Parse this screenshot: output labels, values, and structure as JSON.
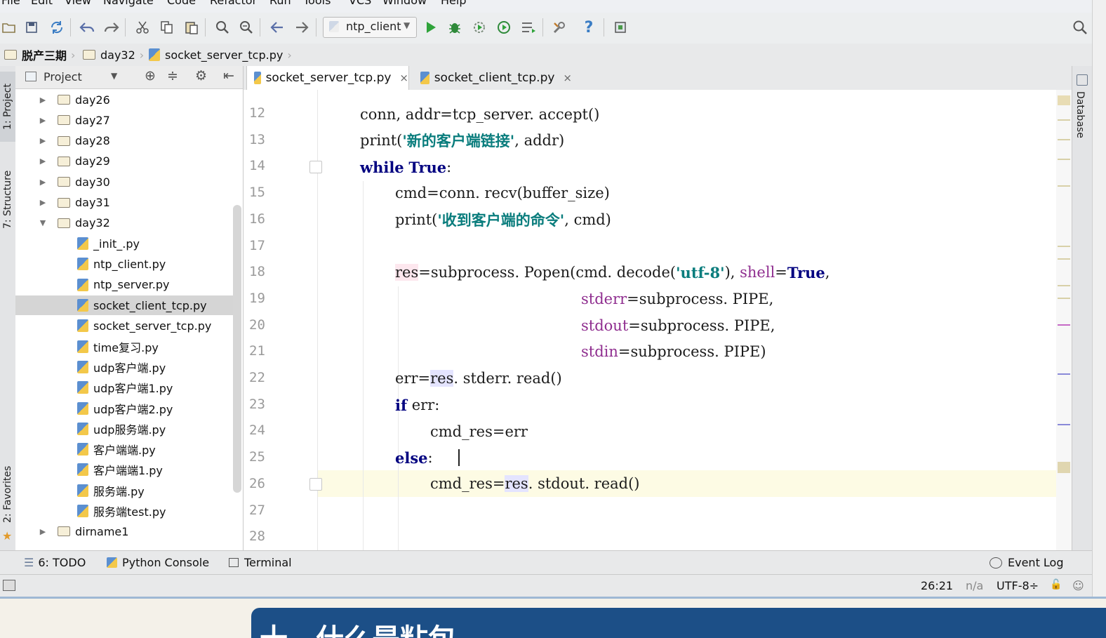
{
  "menu": [
    "File",
    "Edit",
    "View",
    "Navigate",
    "Code",
    "Refactor",
    "Run",
    "Tools",
    "VCS",
    "Window",
    "Help"
  ],
  "toolbar": {
    "run_config": "ntp_client"
  },
  "breadcrumb": [
    "脱产三期",
    "day32",
    "socket_server_tcp.py"
  ],
  "left_tabs": [
    "1: Project",
    "7: Structure",
    "2: Favorites"
  ],
  "right_tabs": [
    "Database"
  ],
  "project": {
    "header": "Project",
    "tree": [
      {
        "label": "day26",
        "type": "folder",
        "arrow": "▶",
        "level": 0
      },
      {
        "label": "day27",
        "type": "folder",
        "arrow": "▶",
        "level": 0
      },
      {
        "label": "day28",
        "type": "folder",
        "arrow": "▶",
        "level": 0
      },
      {
        "label": "day29",
        "type": "folder",
        "arrow": "▶",
        "level": 0
      },
      {
        "label": "day30",
        "type": "folder",
        "arrow": "▶",
        "level": 0
      },
      {
        "label": "day31",
        "type": "folder",
        "arrow": "▶",
        "level": 0
      },
      {
        "label": "day32",
        "type": "folder",
        "arrow": "▼",
        "level": 0
      },
      {
        "label": "_init_.py",
        "type": "file",
        "level": 1
      },
      {
        "label": "ntp_client.py",
        "type": "file",
        "level": 1
      },
      {
        "label": "ntp_server.py",
        "type": "file",
        "level": 1
      },
      {
        "label": "socket_client_tcp.py",
        "type": "file",
        "level": 1,
        "selected": true
      },
      {
        "label": "socket_server_tcp.py",
        "type": "file",
        "level": 1
      },
      {
        "label": "time复习.py",
        "type": "file",
        "level": 1
      },
      {
        "label": "udp客户端.py",
        "type": "file",
        "level": 1
      },
      {
        "label": "udp客户端1.py",
        "type": "file",
        "level": 1
      },
      {
        "label": "udp客户端2.py",
        "type": "file",
        "level": 1
      },
      {
        "label": "udp服务端.py",
        "type": "file",
        "level": 1
      },
      {
        "label": "客户端端.py",
        "type": "file",
        "level": 1
      },
      {
        "label": "客户端端1.py",
        "type": "file",
        "level": 1
      },
      {
        "label": "服务端.py",
        "type": "file",
        "level": 1
      },
      {
        "label": "服务端test.py",
        "type": "file",
        "level": 1
      },
      {
        "label": "dirname1",
        "type": "folder",
        "arrow": "▶",
        "level": 0
      }
    ]
  },
  "editor": {
    "tabs": [
      {
        "label": "socket_server_tcp.py",
        "active": true
      },
      {
        "label": "socket_client_tcp.py",
        "active": false
      }
    ],
    "close_glyph": "×",
    "line_numbers": [
      "12",
      "13",
      "14",
      "15",
      "16",
      "17",
      "18",
      "19",
      "20",
      "21",
      "22",
      "23",
      "24",
      "25",
      "26",
      "27",
      "28"
    ],
    "current_line": "26",
    "code": {
      "l12": "conn, addr=tcp_server. accept()",
      "l13_a": "print(",
      "l13_s": "'新的客户端链接'",
      "l13_b": ", addr)",
      "l14_kw1": "while",
      "l14_kw2": "True",
      "l14_b": ":",
      "l15": "cmd=conn. recv(buffer_size)",
      "l16_a": "print(",
      "l16_s": "'收到客户端的命令'",
      "l16_b": ", cmd)",
      "l18_res": "res",
      "l18_a": "=subprocess. Popen(cmd. decode(",
      "l18_s": "'utf-8'",
      "l18_b": "), ",
      "l18_kwarg": "shell",
      "l18_c": "=",
      "l18_true": "True",
      "l18_d": ",",
      "l19_kwarg": "stderr",
      "l19_b": "=subprocess. PIPE,",
      "l20_kwarg": "stdout",
      "l20_b": "=subprocess. PIPE,",
      "l21_kwarg": "stdin",
      "l21_b": "=subprocess. PIPE)",
      "l22_a": "err=",
      "l22_res": "res",
      "l22_b": ". stderr. read()",
      "l23_kw": "if",
      "l23_b": " err:",
      "l24": "cmd_res=err",
      "l25_kw": "else",
      "l25_b": ":",
      "l26_a": "cmd_res=",
      "l26_res": "res",
      "l26_b": ". stdout. read()"
    }
  },
  "bottom_tabs": [
    {
      "label": "6: TODO"
    },
    {
      "label": "Python Console"
    },
    {
      "label": "Terminal"
    }
  ],
  "event_log": "Event Log",
  "status": {
    "position": "26:21",
    "na": "n/a",
    "encoding": "UTF-8÷"
  },
  "slide_title": "十、什么是粘包"
}
